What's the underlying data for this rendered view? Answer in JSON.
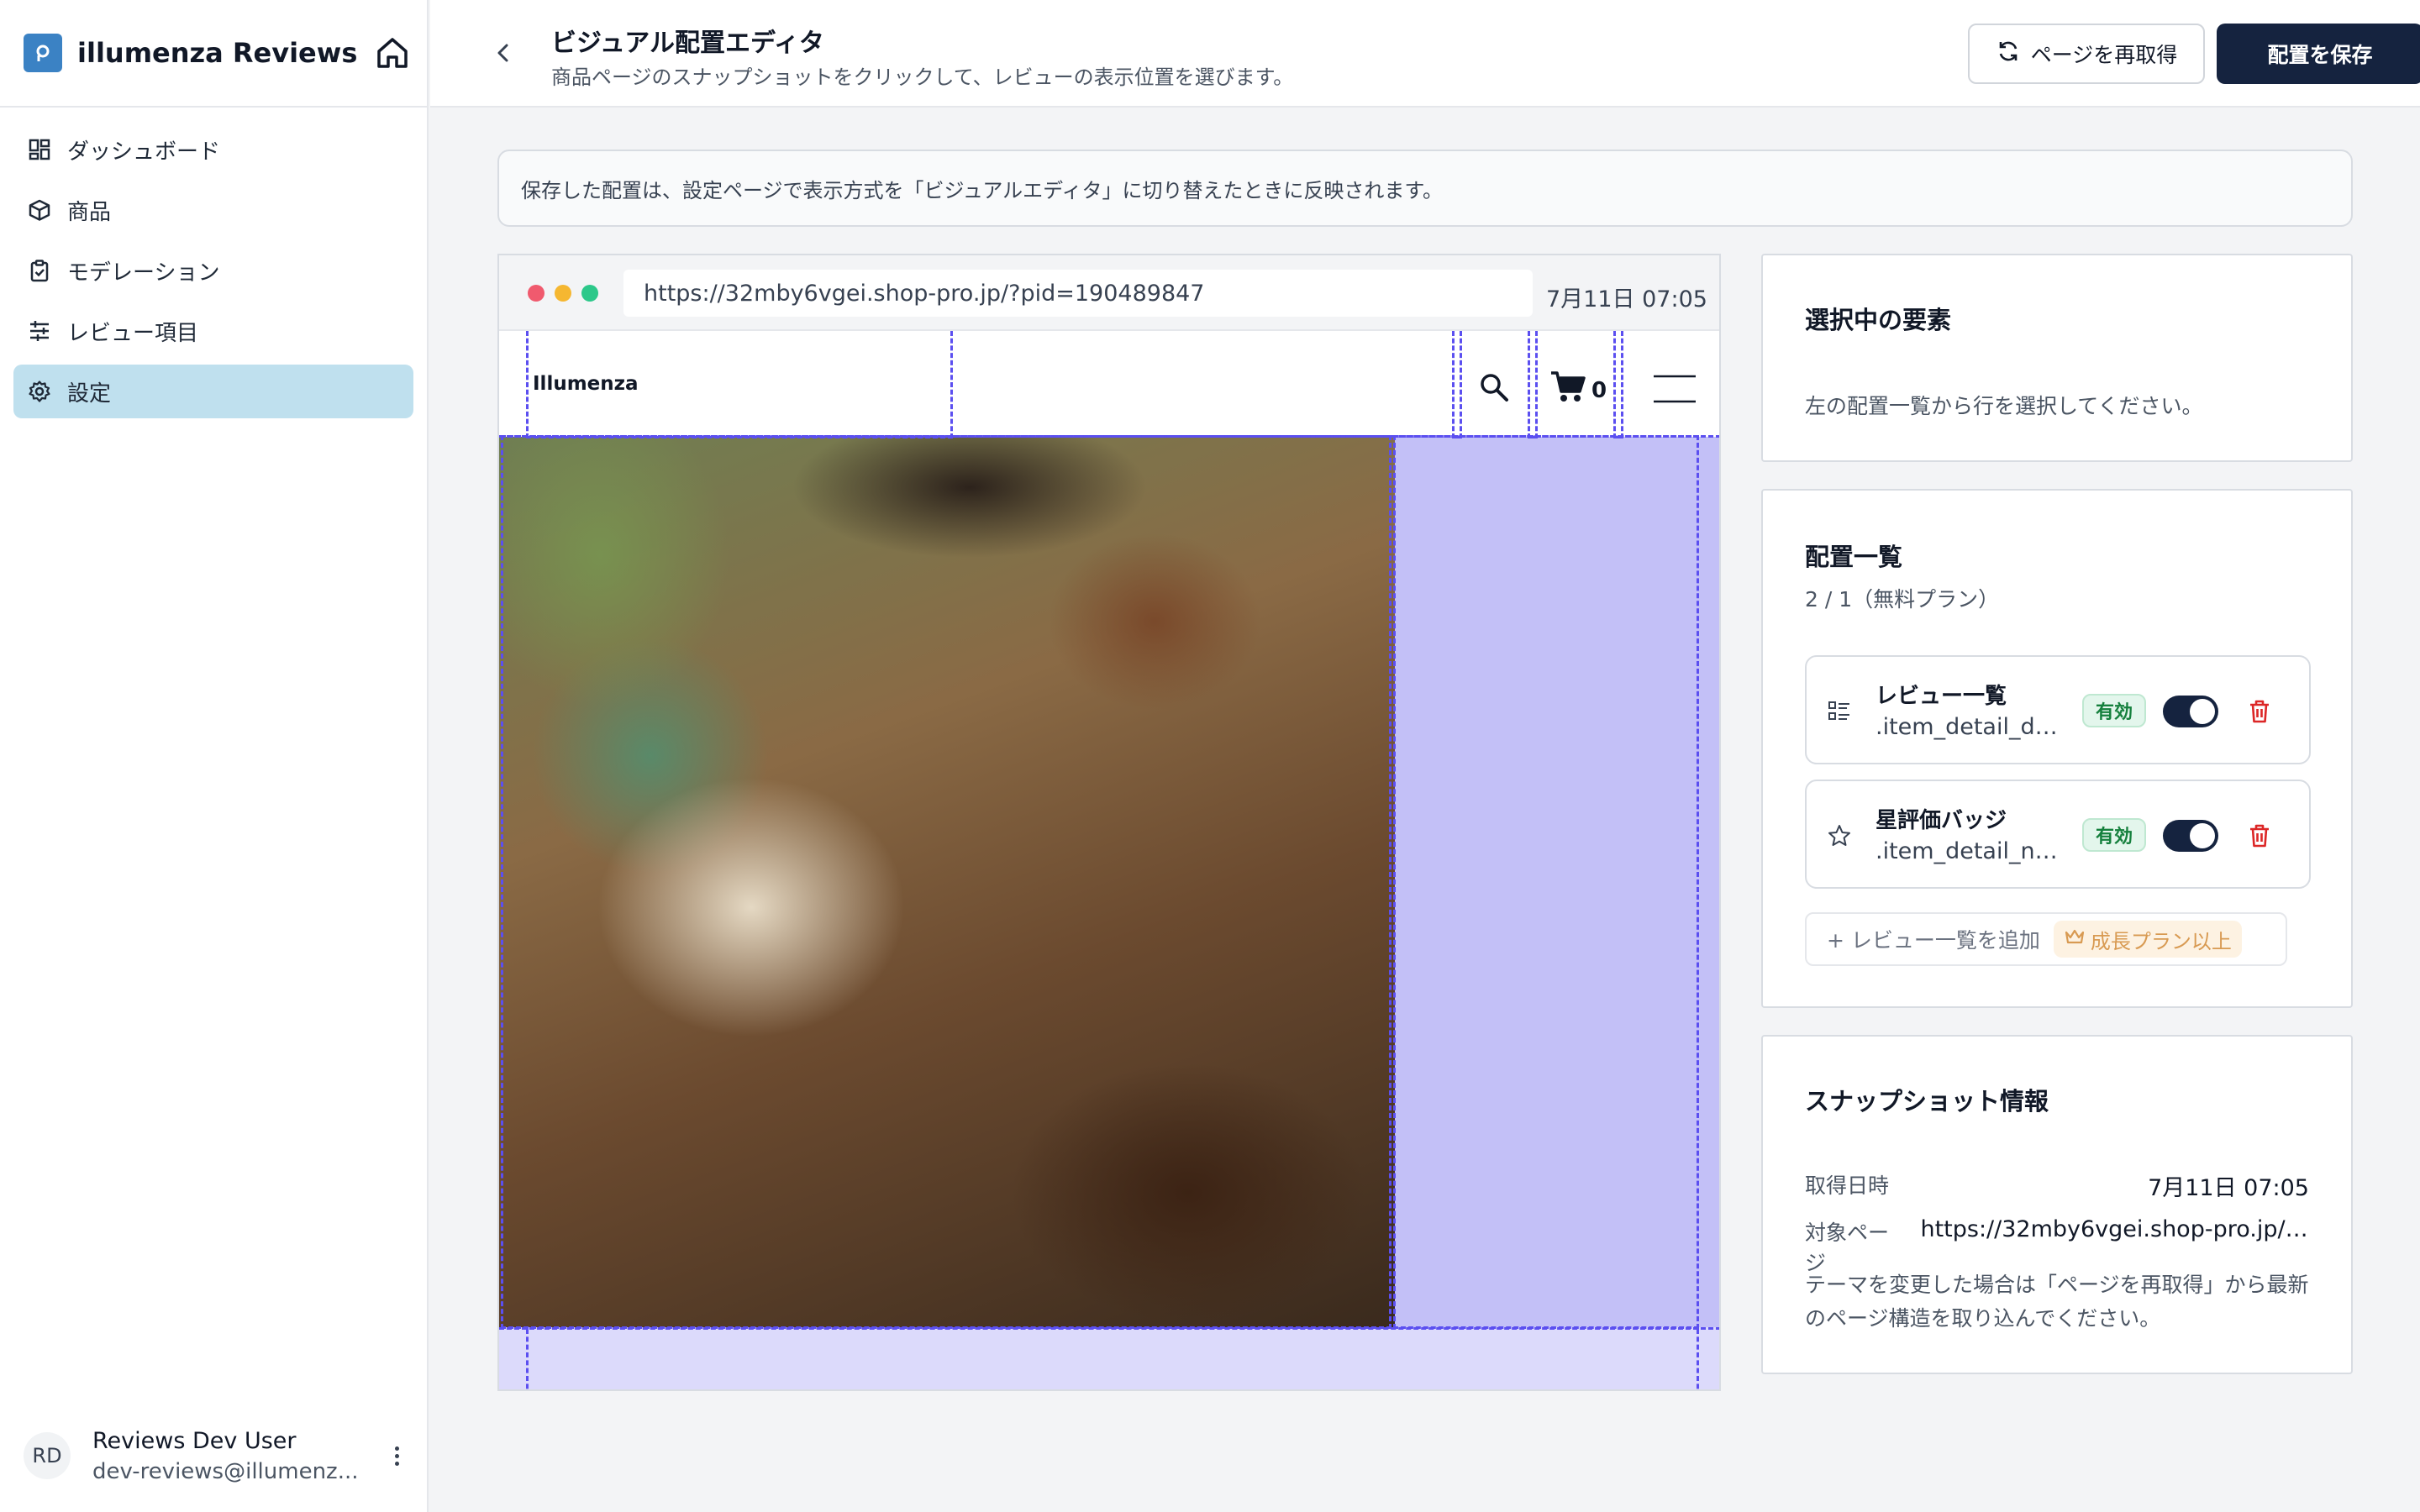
{
  "app": {
    "name": "illumenza Reviews"
  },
  "sidebar": {
    "items": [
      {
        "label": "ダッシュボード",
        "icon": "dashboard-icon"
      },
      {
        "label": "商品",
        "icon": "package-icon"
      },
      {
        "label": "モデレーション",
        "icon": "clipboard-icon"
      },
      {
        "label": "レビュー項目",
        "icon": "sliders-icon"
      },
      {
        "label": "設定",
        "icon": "gear-icon",
        "active": true
      }
    ]
  },
  "user": {
    "initials": "RD",
    "name": "Reviews Dev User",
    "email": "dev-reviews@illumenz..."
  },
  "header": {
    "title": "ビジュアル配置エディタ",
    "subtitle": "商品ページのスナップショットをクリックして、レビューの表示位置を選びます。",
    "refetch_label": "ページを再取得",
    "save_label": "配置を保存"
  },
  "banner": {
    "text": "保存した配置は、設定ページで表示方式を「ビジュアルエディタ」に切り替えたときに反映されます。"
  },
  "preview": {
    "url": "https://32mby6vgei.shop-pro.jp/?pid=190489847",
    "time": "7月11日 07:05",
    "site_logo": "Illumenza",
    "cart_count": "0"
  },
  "selected_card": {
    "title": "選択中の要素",
    "hint": "左の配置一覧から行を選択してください。"
  },
  "placements_card": {
    "title": "配置一覧",
    "usage": "2 / 1（無料プラン）",
    "rows": [
      {
        "name": "レビュー一覧",
        "selector": ".item_detail_de...",
        "status": "有効",
        "enabled": true,
        "icon": "list-icon"
      },
      {
        "name": "星評価バッジ",
        "selector": ".item_detail_na...",
        "status": "有効",
        "enabled": true,
        "icon": "star-icon"
      }
    ],
    "add_label": "+ レビュー一覧を追加",
    "plan_label": "成長プラン以上"
  },
  "snapshot_card": {
    "title": "スナップショット情報",
    "fetched_label": "取得日時",
    "fetched_value": "7月11日 07:05",
    "page_label": "対象ページ",
    "page_value": "https://32mby6vgei.shop-pro.jp/?...",
    "note": "テーマを変更した場合は「ページを再取得」から最新のページ構造を取り込んでください。"
  },
  "colors": {
    "primary": "#15233f",
    "accent": "#3b82c4",
    "active_nav": "#bfe0ee",
    "selection_outline": "#5b4ff0",
    "selection_fill": "#c3c0f7",
    "success": "#15803d",
    "danger": "#dc2626"
  }
}
